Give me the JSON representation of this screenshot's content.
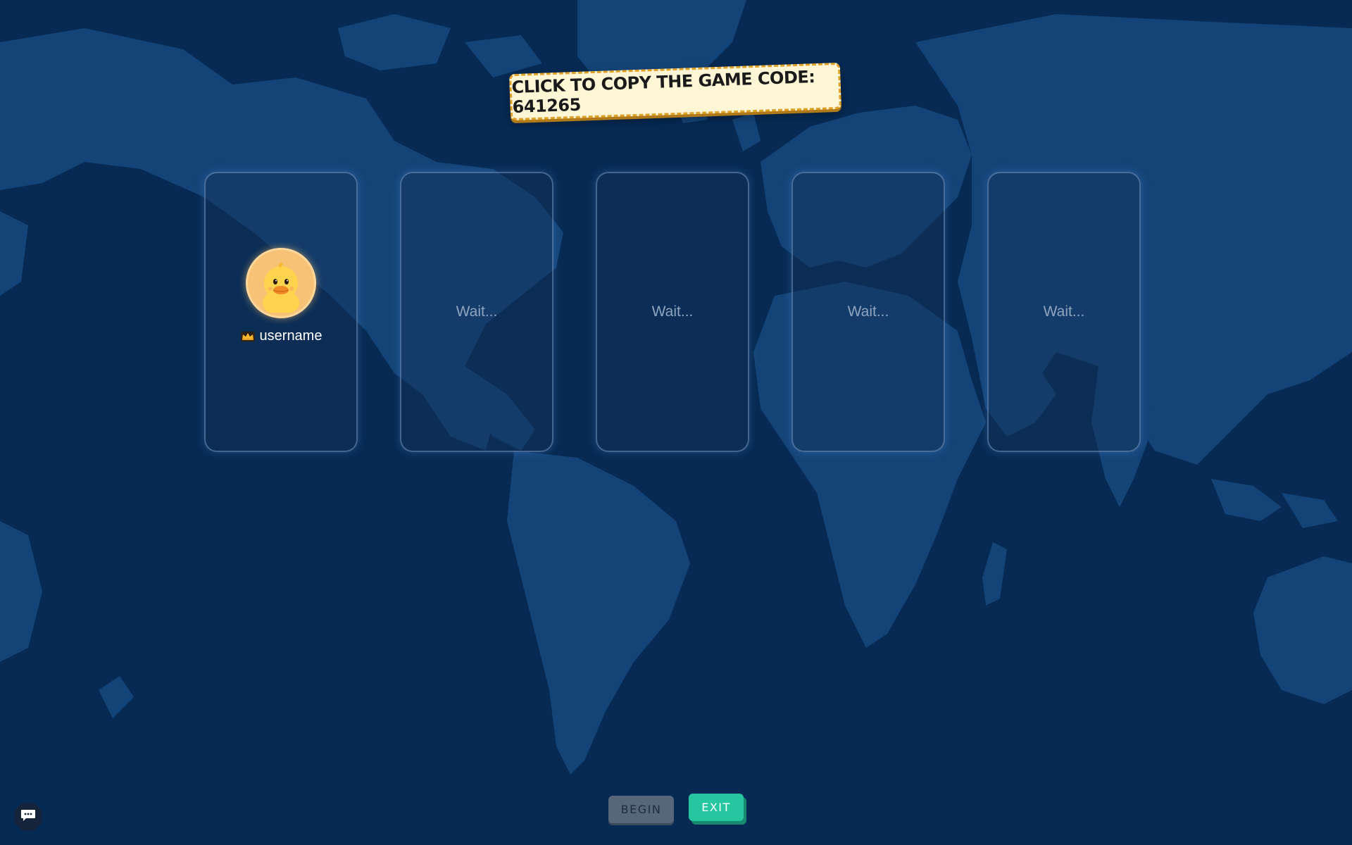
{
  "game": {
    "code_banner_text": "CLICK TO COPY THE GAME CODE: 641265",
    "game_code": "641265"
  },
  "players": {
    "host": {
      "name": "username",
      "avatar": "duck-avatar",
      "badge_icon": "crown-icon"
    },
    "waiting_slots": [
      {
        "label": "Wait..."
      },
      {
        "label": "Wait..."
      },
      {
        "label": "Wait..."
      },
      {
        "label": "Wait..."
      }
    ]
  },
  "controls": {
    "begin_label": "BEGIN",
    "exit_label": "EXIT",
    "chat_icon": "chat-bubble-icon"
  },
  "colors": {
    "background": "#062a52",
    "land": "#17497e",
    "banner_bg": "#fff6d6",
    "banner_border": "#e0a12a",
    "begin_disabled": "#56677c",
    "exit_accent": "#25c6a0"
  }
}
